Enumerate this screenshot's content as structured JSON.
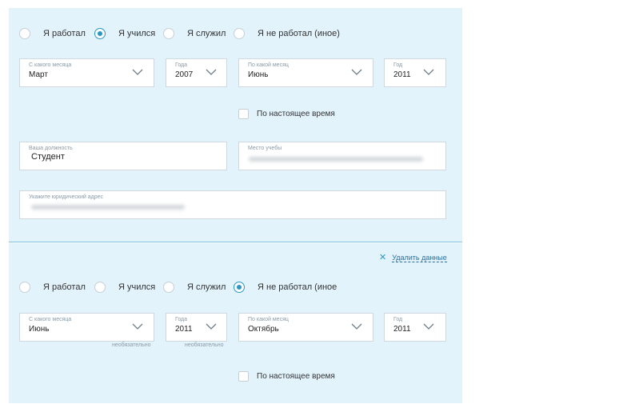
{
  "block1": {
    "radios": [
      {
        "label": "Я работал",
        "checked": false
      },
      {
        "label": "Я учился",
        "checked": true
      },
      {
        "label": "Я служил",
        "checked": false
      },
      {
        "label": "Я не работал (иное)",
        "checked": false
      }
    ],
    "from_month": {
      "label": "С какого месяца",
      "value": "Март"
    },
    "from_year": {
      "label": "Года",
      "value": "2007"
    },
    "to_month": {
      "label": "По какой месяц",
      "value": "Июнь"
    },
    "to_year": {
      "label": "Год",
      "value": "2011"
    },
    "present": {
      "label": "По настоящее время",
      "checked": false
    },
    "position": {
      "label": "Ваша должность",
      "value": "Студент"
    },
    "place": {
      "label": "Место учебы"
    },
    "address": {
      "label": "Укажите юридический адрес"
    }
  },
  "block2": {
    "delete_label": "Удалить данные",
    "radios": [
      {
        "label": "Я работал",
        "checked": false
      },
      {
        "label": "Я учился",
        "checked": false
      },
      {
        "label": "Я служил",
        "checked": false
      },
      {
        "label": "Я не работал (иное",
        "checked": true
      }
    ],
    "from_month": {
      "label": "С какого месяца",
      "value": "Июнь",
      "hint": "необязательно"
    },
    "from_year": {
      "label": "Года",
      "value": "2011",
      "hint": "необязательно"
    },
    "to_month": {
      "label": "По какой месяц",
      "value": "Октябрь"
    },
    "to_year": {
      "label": "Год",
      "value": "2011"
    },
    "present": {
      "label": "По настоящее время",
      "checked": false
    }
  },
  "colors": {
    "panel": "#e2f3fc",
    "accent": "#2c97c1",
    "divider": "#7cc4dc"
  },
  "icons": {
    "select": "chevron-down-icon",
    "delete": "close-icon"
  }
}
